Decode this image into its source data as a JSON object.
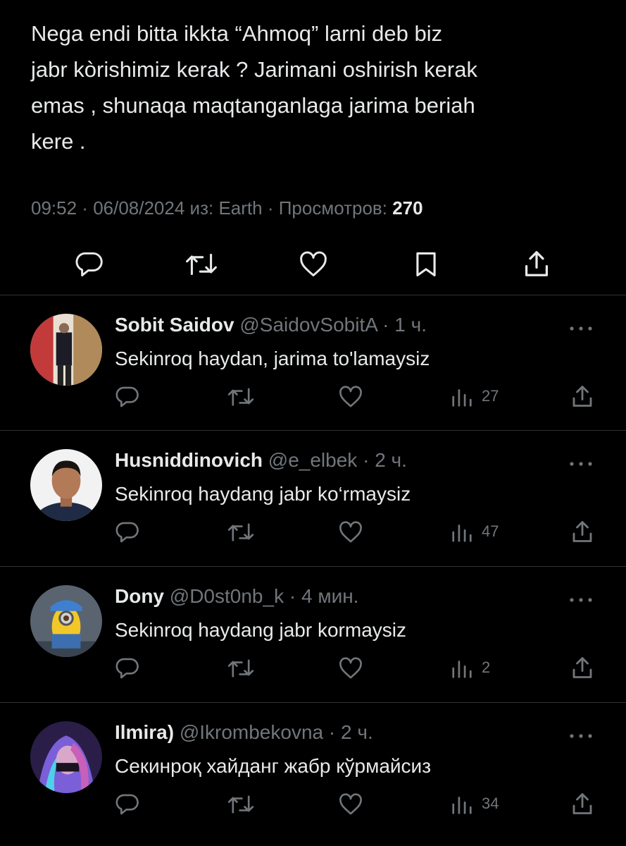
{
  "main_tweet": {
    "text": "Nega endi bitta ikkta “Ahmoq” larni deb biz\njabr kòrishimiz kerak ? Jarimani oshirish kerak\nemas , shunaqa maqtanganlaga jarima beriah\nkere .",
    "time": "09:52",
    "sep1": " · ",
    "date": "06/08/2024",
    "source_prefix": " из: ",
    "source": "Earth",
    "sep2": " · ",
    "views_label": "Просмотров: ",
    "views": "270"
  },
  "replies": [
    {
      "name": "Sobit Saidov",
      "handle": "@SaidovSobitA",
      "time": "1 ч.",
      "text": "Sekinroq haydan, jarima to'lamaysiz",
      "views": "27"
    },
    {
      "name": "Husniddinovich",
      "handle": "@e_elbek",
      "time": "2 ч.",
      "text": "Sekinroq haydang jabr ko‘rmaysiz",
      "views": "47"
    },
    {
      "name": "Dony",
      "handle": "@D0st0nb_k",
      "time": "4 мин.",
      "text": "Sekinroq haydang jabr kormaysiz",
      "views": "2"
    },
    {
      "name": "Ilmira)",
      "handle": "@Ikrombekovna",
      "time": "2 ч.",
      "text": "Секинроқ хайданг жабр кўрмайсиз",
      "views": "34"
    }
  ],
  "icons": {
    "reply": "reply-icon",
    "retweet": "retweet-icon",
    "like": "heart-icon",
    "bookmark": "bookmark-icon",
    "share": "share-icon",
    "views": "views-chart-icon",
    "more": "more-icon"
  },
  "colors": {
    "background": "#000000",
    "text": "#e7e9ea",
    "secondary": "#71767b",
    "divider": "#2f3336"
  }
}
